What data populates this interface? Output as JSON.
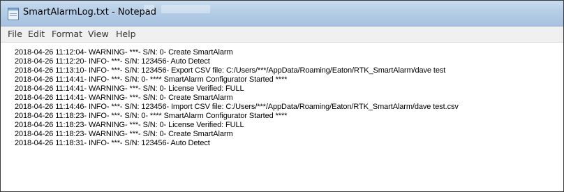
{
  "window": {
    "title": "SmartAlarmLog.txt - Notepad"
  },
  "menu": [
    "File",
    "Edit",
    "Format",
    "View",
    "Help"
  ],
  "lines": [
    "2018-04-26 11:12:04- WARNING- ***- S/N: 0- Create SmartAlarm",
    "2018-04-26 11:12:20- INFO- ***- S/N: 123456- Auto Detect",
    "2018-04-26 11:13:10- INFO- ***- S/N: 123456- Export CSV file: C:/Users/***/AppData/Roaming/Eaton/RTK_SmartAlarm/dave test",
    "2018-04-26 11:14:41- INFO- ***- S/N: 0- **** SmartAlarm Configurator Started ****",
    "2018-04-26 11:14:41- WARNING- ***- S/N: 0- License Verified: FULL",
    "2018-04-26 11:14:41- WARNING- ***- S/N: 0- Create SmartAlarm",
    "2018-04-26 11:14:46- INFO- ***- S/N: 123456- Import CSV file: C:/Users/***/AppData/Roaming/Eaton/RTK_SmartAlarm/dave test.csv",
    "2018-04-26 11:18:23- INFO- ***- S/N: 0- **** SmartAlarm Configurator Started ****",
    "2018-04-26 11:18:23- WARNING- ***- S/N: 0- License Verified: FULL",
    "2018-04-26 11:18:23- WARNING- ***- S/N: 0- Create SmartAlarm",
    "2018-04-26 11:18:31- INFO- ***- S/N: 123456- Auto Detect"
  ]
}
